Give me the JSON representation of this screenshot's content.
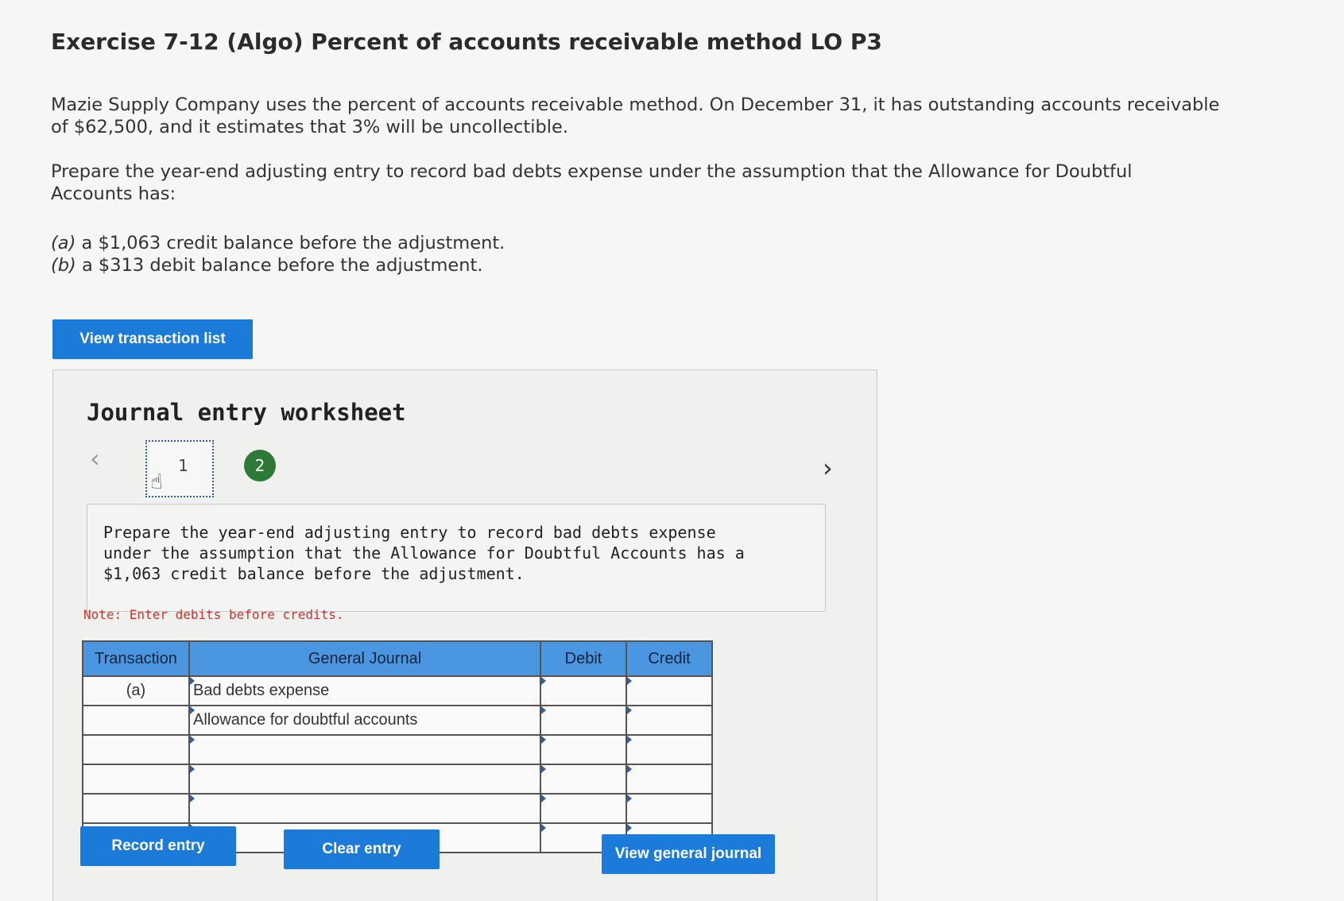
{
  "header": {
    "title": "Exercise 7-12 (Algo) Percent of accounts receivable method LO P3"
  },
  "problem": {
    "paragraph1": "Mazie Supply Company uses the percent of accounts receivable method. On December 31, it has outstanding accounts receivable of $62,500, and it estimates that 3% will be uncollectible.",
    "paragraph2": "Prepare the year-end adjusting entry to record bad debts expense under the assumption that the Allowance for Doubtful Accounts has:",
    "items": [
      {
        "label": "(a)",
        "text": " a $1,063 credit balance before the adjustment."
      },
      {
        "label": "(b)",
        "text": " a $313 debit balance before the adjustment."
      }
    ]
  },
  "buttons": {
    "view_transaction_list": "View transaction list",
    "record_entry": "Record entry",
    "clear_entry": "Clear entry",
    "view_general_journal": "View general journal"
  },
  "worksheet": {
    "title": "Journal entry worksheet",
    "tabs": [
      "1",
      "2"
    ],
    "instruction": "Prepare the year-end adjusting entry to record bad debts expense under the assumption that the Allowance for Doubtful Accounts has a $1,063 credit balance before the adjustment.",
    "note": "Note: Enter debits before credits."
  },
  "journal": {
    "columns": [
      "Transaction",
      "General Journal",
      "Debit",
      "Credit"
    ],
    "rows": [
      {
        "transaction": "(a)",
        "account": "Bad debts expense",
        "debit": "",
        "credit": ""
      },
      {
        "transaction": "",
        "account": "Allowance for doubtful accounts",
        "debit": "",
        "credit": ""
      },
      {
        "transaction": "",
        "account": "",
        "debit": "",
        "credit": ""
      },
      {
        "transaction": "",
        "account": "",
        "debit": "",
        "credit": ""
      },
      {
        "transaction": "",
        "account": "",
        "debit": "",
        "credit": ""
      },
      {
        "transaction": "",
        "account": "",
        "debit": "",
        "credit": ""
      }
    ]
  },
  "colors": {
    "accent_button": "#1c7ad8",
    "table_header": "#4a96e0",
    "tab_complete": "#2d7a38",
    "note_text": "#c0392b"
  },
  "icons": {
    "prev": "chevron-left-icon",
    "next": "chevron-right-icon",
    "cursor": "hand-pointer-icon"
  }
}
